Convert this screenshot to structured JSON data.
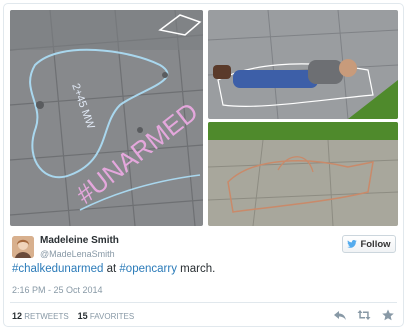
{
  "user": {
    "name": "Madeleine Smith",
    "handle": "@MadeLenaSmith"
  },
  "follow_label": "Follow",
  "tweet": {
    "hashtag1": "#chalkedunarmed",
    "middle": " at ",
    "hashtag2": "#opencarry",
    "end": " march."
  },
  "timestamp": "2:16 PM - 25 Oct 2014",
  "stats": {
    "retweets_count": "12",
    "retweets_label": "RETWEETS",
    "favorites_count": "15",
    "favorites_label": "FAVORITES"
  },
  "media": {
    "chalk_text": "#UNARMED",
    "chalk_small": "2+45 MW"
  },
  "colors": {
    "link": "#2b7bb9",
    "name": "#292f33",
    "muted": "#8899a6",
    "pavement": "#8d8f93",
    "grass": "#4f8a2c",
    "chalk_pink": "#e4a7dc",
    "chalk_blue": "#a9d7ee"
  }
}
